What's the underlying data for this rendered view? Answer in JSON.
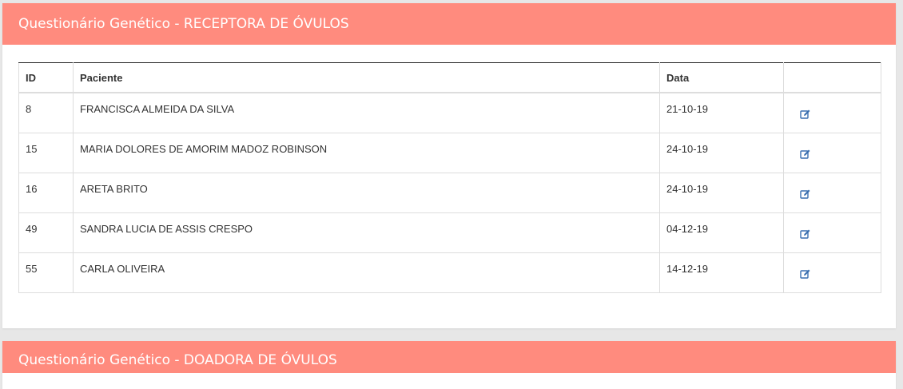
{
  "panel1": {
    "title": "Questionário Genético - RECEPTORA DE ÓVULOS",
    "table": {
      "headers": [
        "ID",
        "Paciente",
        "Data",
        ""
      ],
      "rows": [
        {
          "id": "8",
          "paciente": "FRANCISCA ALMEIDA DA SILVA",
          "data": "21-10-19",
          "action_icon": "edit-icon"
        },
        {
          "id": "15",
          "paciente": "MARIA DOLORES DE AMORIM MADOZ ROBINSON",
          "data": "24-10-19",
          "action_icon": "edit-icon"
        },
        {
          "id": "16",
          "paciente": "ARETA BRITO",
          "data": "24-10-19",
          "action_icon": "edit-icon"
        },
        {
          "id": "49",
          "paciente": "SANDRA LUCIA DE ASSIS CRESPO",
          "data": "04-12-19",
          "action_icon": "edit-icon"
        },
        {
          "id": "55",
          "paciente": "CARLA OLIVEIRA",
          "data": "14-12-19",
          "action_icon": "edit-icon"
        }
      ]
    }
  },
  "panel2": {
    "title": "Questionário Genético - DOADORA DE ÓVULOS"
  },
  "colors": {
    "header_bg": "#ff8b7e",
    "link_icon": "#3a6fb0"
  }
}
